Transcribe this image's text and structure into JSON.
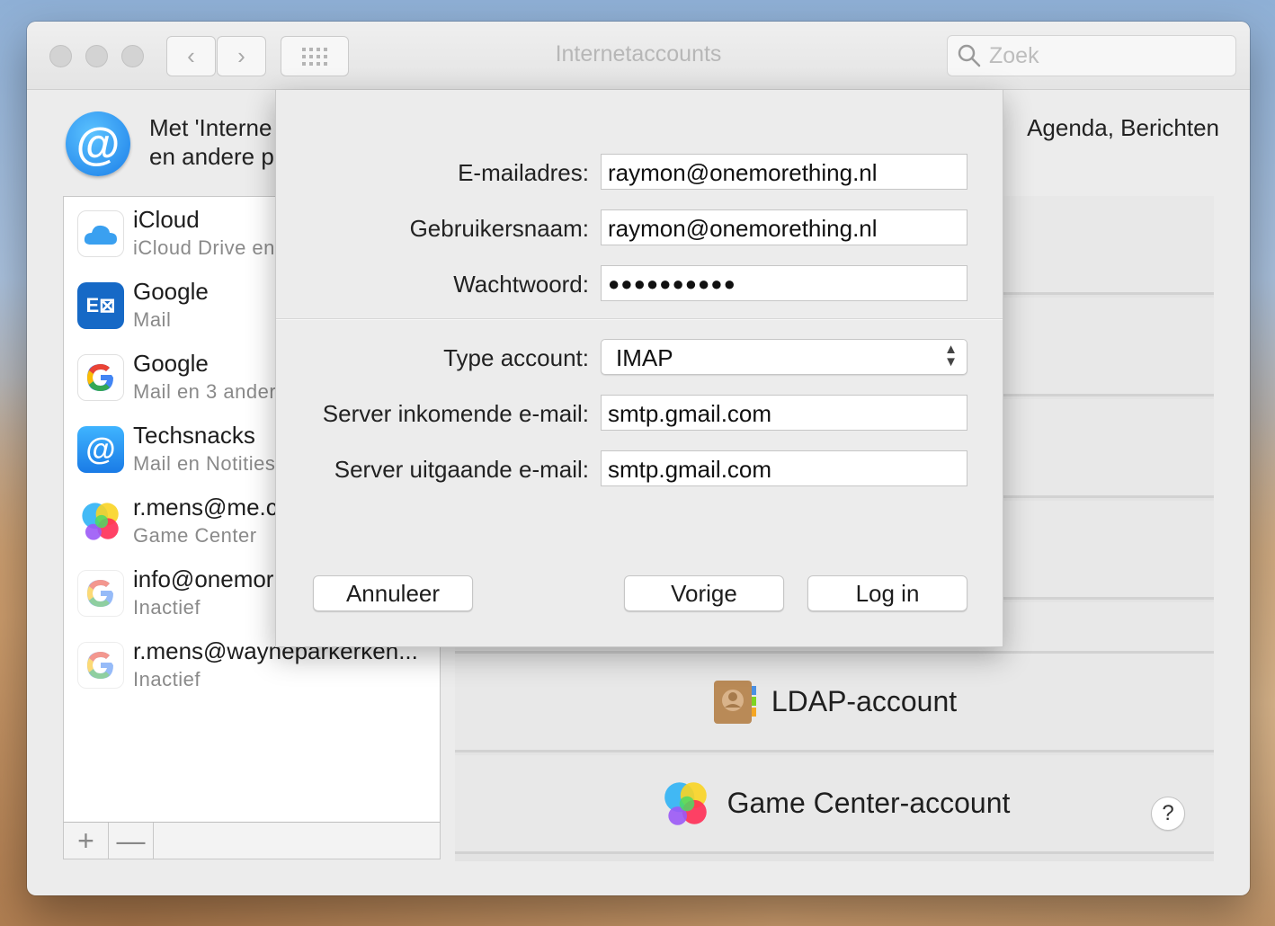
{
  "window": {
    "title": "Internetaccounts"
  },
  "search": {
    "placeholder": "Zoek"
  },
  "header": {
    "text_line1": "Met 'Interne",
    "text_line2": "en andere p",
    "text_right": "Agenda, Berichten"
  },
  "accounts": [
    {
      "name": "iCloud",
      "sub": "iCloud Drive en",
      "icon": "icloud-icon"
    },
    {
      "name": "Google",
      "sub": "Mail",
      "icon": "exchange-icon"
    },
    {
      "name": "Google",
      "sub": "Mail en 3 ander",
      "icon": "google-icon"
    },
    {
      "name": "Techsnacks",
      "sub": "Mail en Notities",
      "icon": "at-mail-icon"
    },
    {
      "name": "r.mens@me.c",
      "sub": "Game Center",
      "icon": "game-center-icon"
    },
    {
      "name": "info@onemor",
      "sub": "Inactief",
      "icon": "google-icon"
    },
    {
      "name": "r.mens@wayneparkerken...",
      "sub": "Inactief",
      "icon": "google-icon"
    }
  ],
  "list_footer": {
    "add": "+",
    "remove": "—"
  },
  "providers": [
    {
      "label": "LDAP-account",
      "icon": "contacts-book-icon"
    },
    {
      "label": "Game Center-account",
      "icon": "game-center-icon"
    }
  ],
  "help": "?",
  "sheet": {
    "email_label": "E-mailadres:",
    "email_value": "raymon@onemorething.nl",
    "username_label": "Gebruikersnaam:",
    "username_value": "raymon@onemorething.nl",
    "password_label": "Wachtwoord:",
    "password_value": "●●●●●●●●●●",
    "type_label": "Type account:",
    "type_value": "IMAP",
    "incoming_label": "Server inkomende e-mail:",
    "incoming_value": "smtp.gmail.com",
    "outgoing_label": "Server uitgaande e-mail:",
    "outgoing_value": "smtp.gmail.com",
    "cancel": "Annuleer",
    "previous": "Vorige",
    "login": "Log in"
  }
}
